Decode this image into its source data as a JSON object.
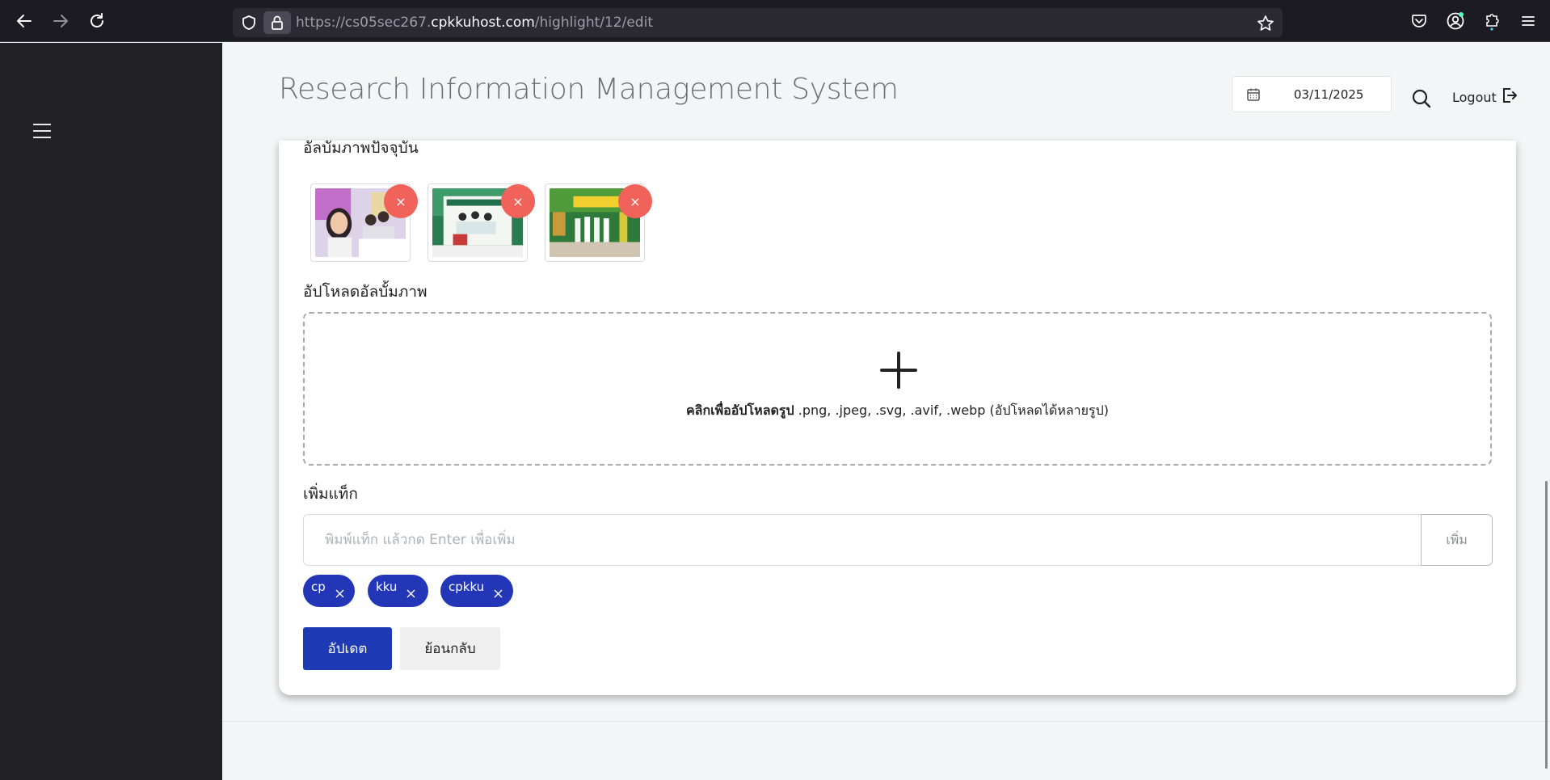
{
  "browser": {
    "url_prefix": "https://cs05sec267.",
    "url_domain": "cpkkuhost.com",
    "url_path": "/highlight/12/edit"
  },
  "header": {
    "title": "Research Information Management System",
    "date": "03/11/2025",
    "logout_label": "Logout"
  },
  "album": {
    "current_label": "อัลบัมภาพปัจจุบัน",
    "remove_glyph": "×",
    "photos": [
      {
        "name": "photo-1"
      },
      {
        "name": "photo-2"
      },
      {
        "name": "photo-3"
      }
    ]
  },
  "upload": {
    "label": "อัปโหลดอัลบั้มภาพ",
    "hint_bold": "คลิกเพื่ออัปโหลดรูป",
    "hint_rest": " .png, .jpeg, .svg, .avif, .webp (อัปโหลดได้หลายรูป)"
  },
  "tags": {
    "label": "เพิ่มแท็ก",
    "placeholder": "พิมพ์แท็ก แล้วกด Enter เพื่อเพิ่ม",
    "add_label": "เพิ่ม",
    "items": [
      "cp",
      "kku",
      "cpkku"
    ]
  },
  "actions": {
    "update_label": "อัปเดต",
    "back_label": "ย้อนกลับ"
  },
  "colors": {
    "primary": "#1f3ab5",
    "chip": "#2336b8",
    "remove": "#f0625a",
    "sidebar": "#212125"
  },
  "icons": [
    "back-arrow-icon",
    "forward-arrow-icon",
    "reload-icon",
    "shield-icon",
    "lock-icon",
    "star-icon",
    "pocket-icon",
    "account-icon",
    "extensions-icon",
    "menu-icon",
    "hamburger-icon",
    "calendar-icon",
    "search-icon",
    "logout-icon",
    "plus-icon",
    "close-icon"
  ]
}
